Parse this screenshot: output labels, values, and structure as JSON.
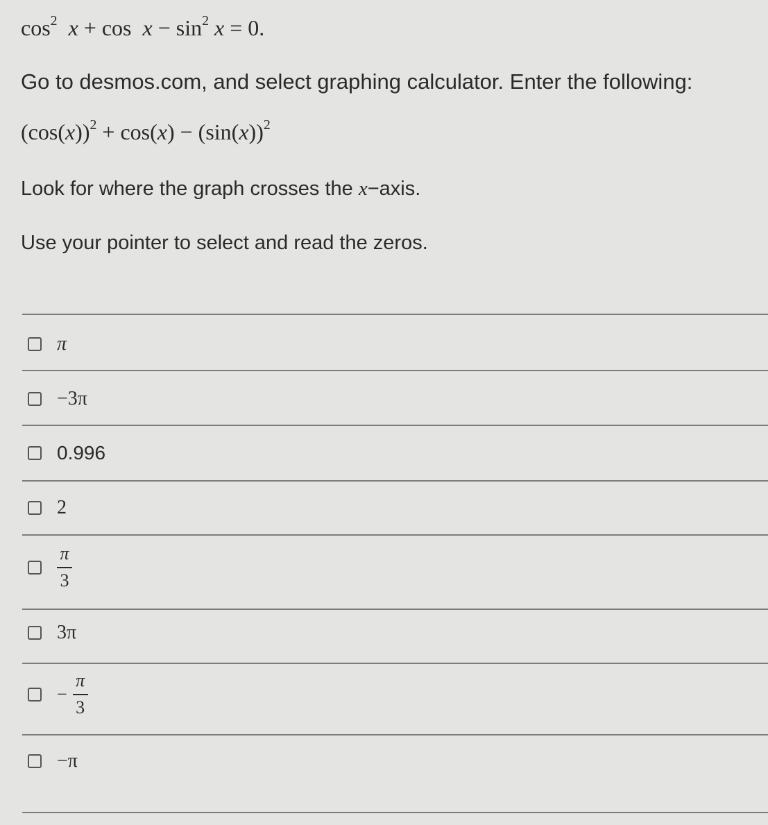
{
  "question": {
    "equation": {
      "parts": [
        "cos",
        "2",
        "x",
        "+ cos",
        "x",
        "− sin",
        "2",
        "x",
        "= 0."
      ]
    },
    "instruction_1": "Go to desmos.com, and select graphing calculator. Enter the following:",
    "expression": {
      "parts": [
        "(cos(",
        "x",
        "))",
        "2",
        " + cos(",
        "x",
        ") − (sin(",
        "x",
        "))",
        "2"
      ]
    },
    "instruction_2": {
      "before": "Look for where the graph crosses the ",
      "var": "x",
      "after": "−axis."
    },
    "instruction_3": "Use your pointer to select and read the zeros."
  },
  "options": [
    {
      "label": "π",
      "checked": false
    },
    {
      "label": "−3π",
      "checked": false
    },
    {
      "label": "0.996",
      "checked": false
    },
    {
      "label": "2",
      "checked": false
    },
    {
      "label": "π/3",
      "numerator": "π",
      "denominator": "3",
      "checked": false
    },
    {
      "label": "3π",
      "checked": false
    },
    {
      "label": "−π/3",
      "sign": "−",
      "numerator": "π",
      "denominator": "3",
      "checked": false
    },
    {
      "label": "−π",
      "checked": false
    }
  ]
}
